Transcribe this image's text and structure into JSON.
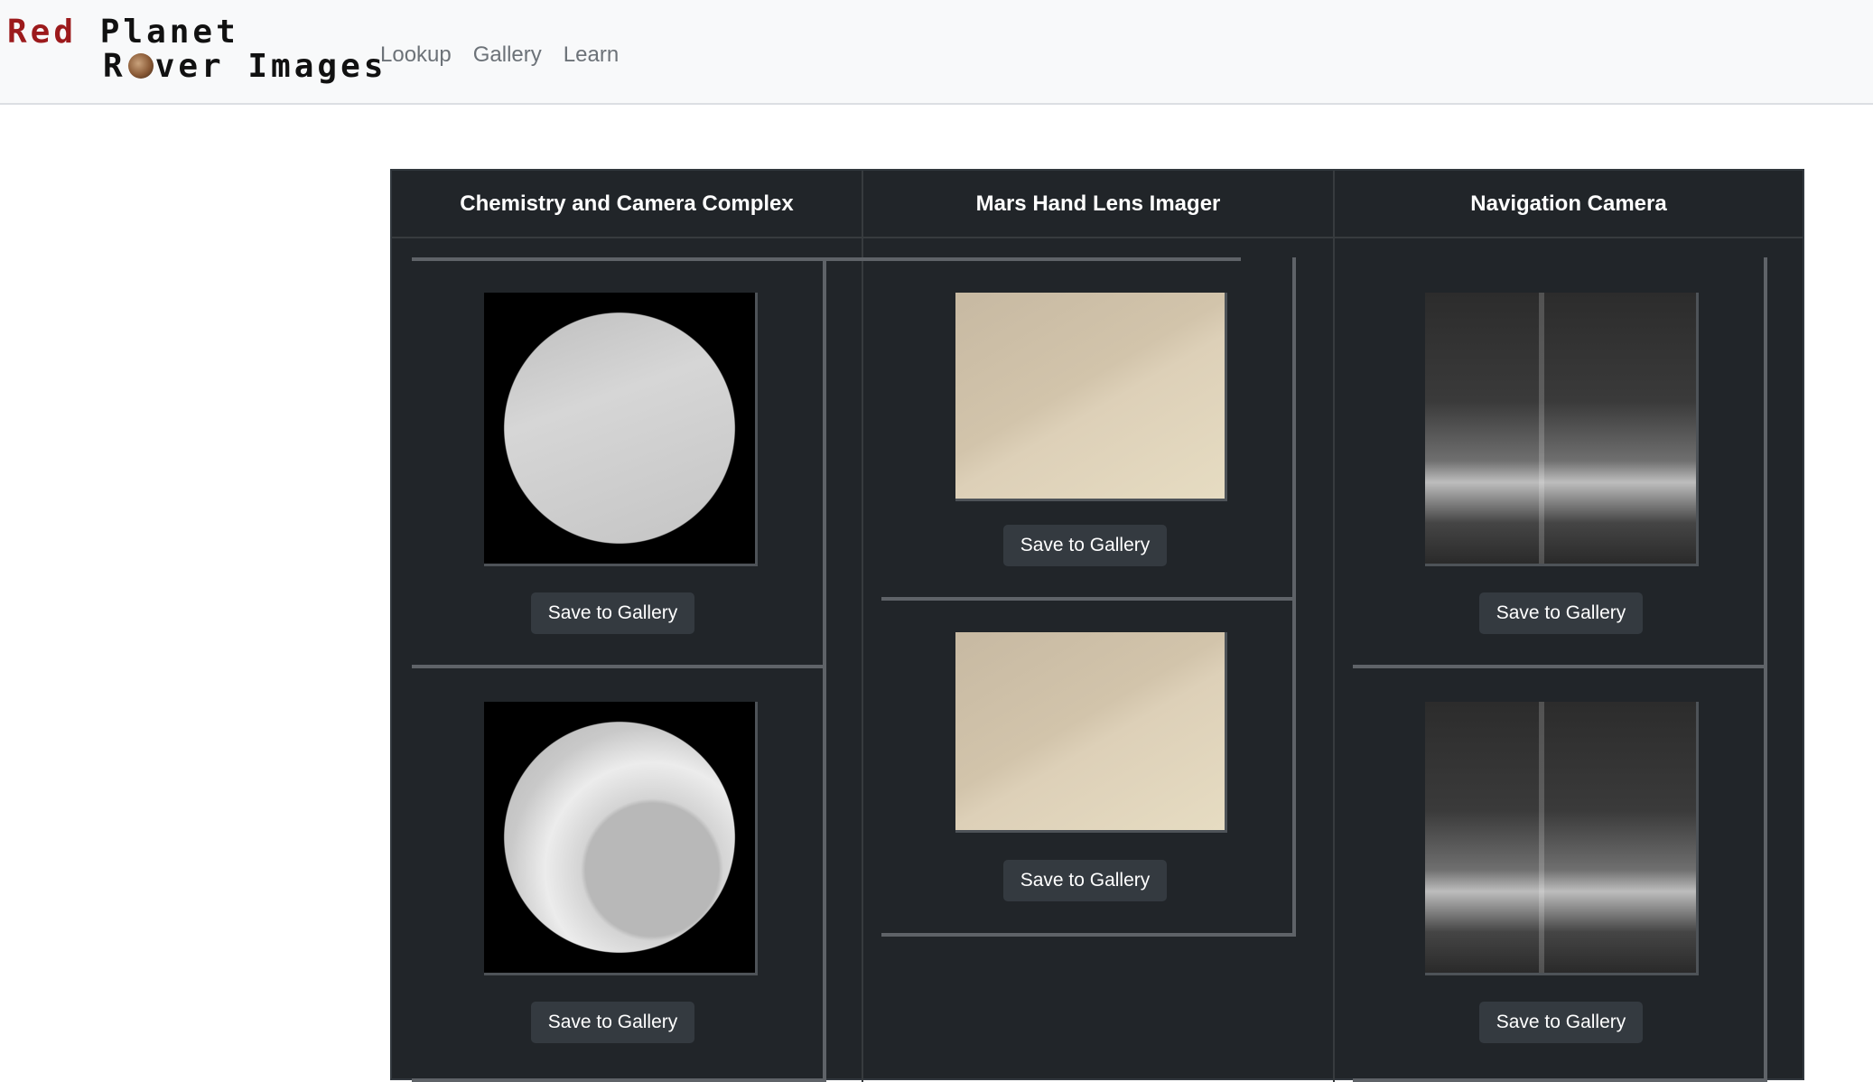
{
  "navbar": {
    "logo": {
      "line1_a": "Red",
      "line1_b": "Planet",
      "line2_a": "R",
      "line2_b": "ver Images"
    },
    "links": [
      "Lookup",
      "Gallery",
      "Learn"
    ]
  },
  "table": {
    "columns": [
      {
        "header": "Chemistry and Camera Complex",
        "images": [
          {
            "button": "Save to Gallery"
          },
          {
            "button": "Save to Gallery"
          }
        ]
      },
      {
        "header": "Mars Hand Lens Imager",
        "images": [
          {
            "button": "Save to Gallery"
          },
          {
            "button": "Save to Gallery"
          }
        ]
      },
      {
        "header": "Navigation Camera",
        "images": [
          {
            "button": "Save to Gallery"
          },
          {
            "button": "Save to Gallery"
          }
        ]
      }
    ]
  },
  "colors": {
    "navbar_bg": "#f8f9fa",
    "table_bg": "#212529",
    "button_bg": "#343a40",
    "logo_red": "#9c1a1c"
  }
}
